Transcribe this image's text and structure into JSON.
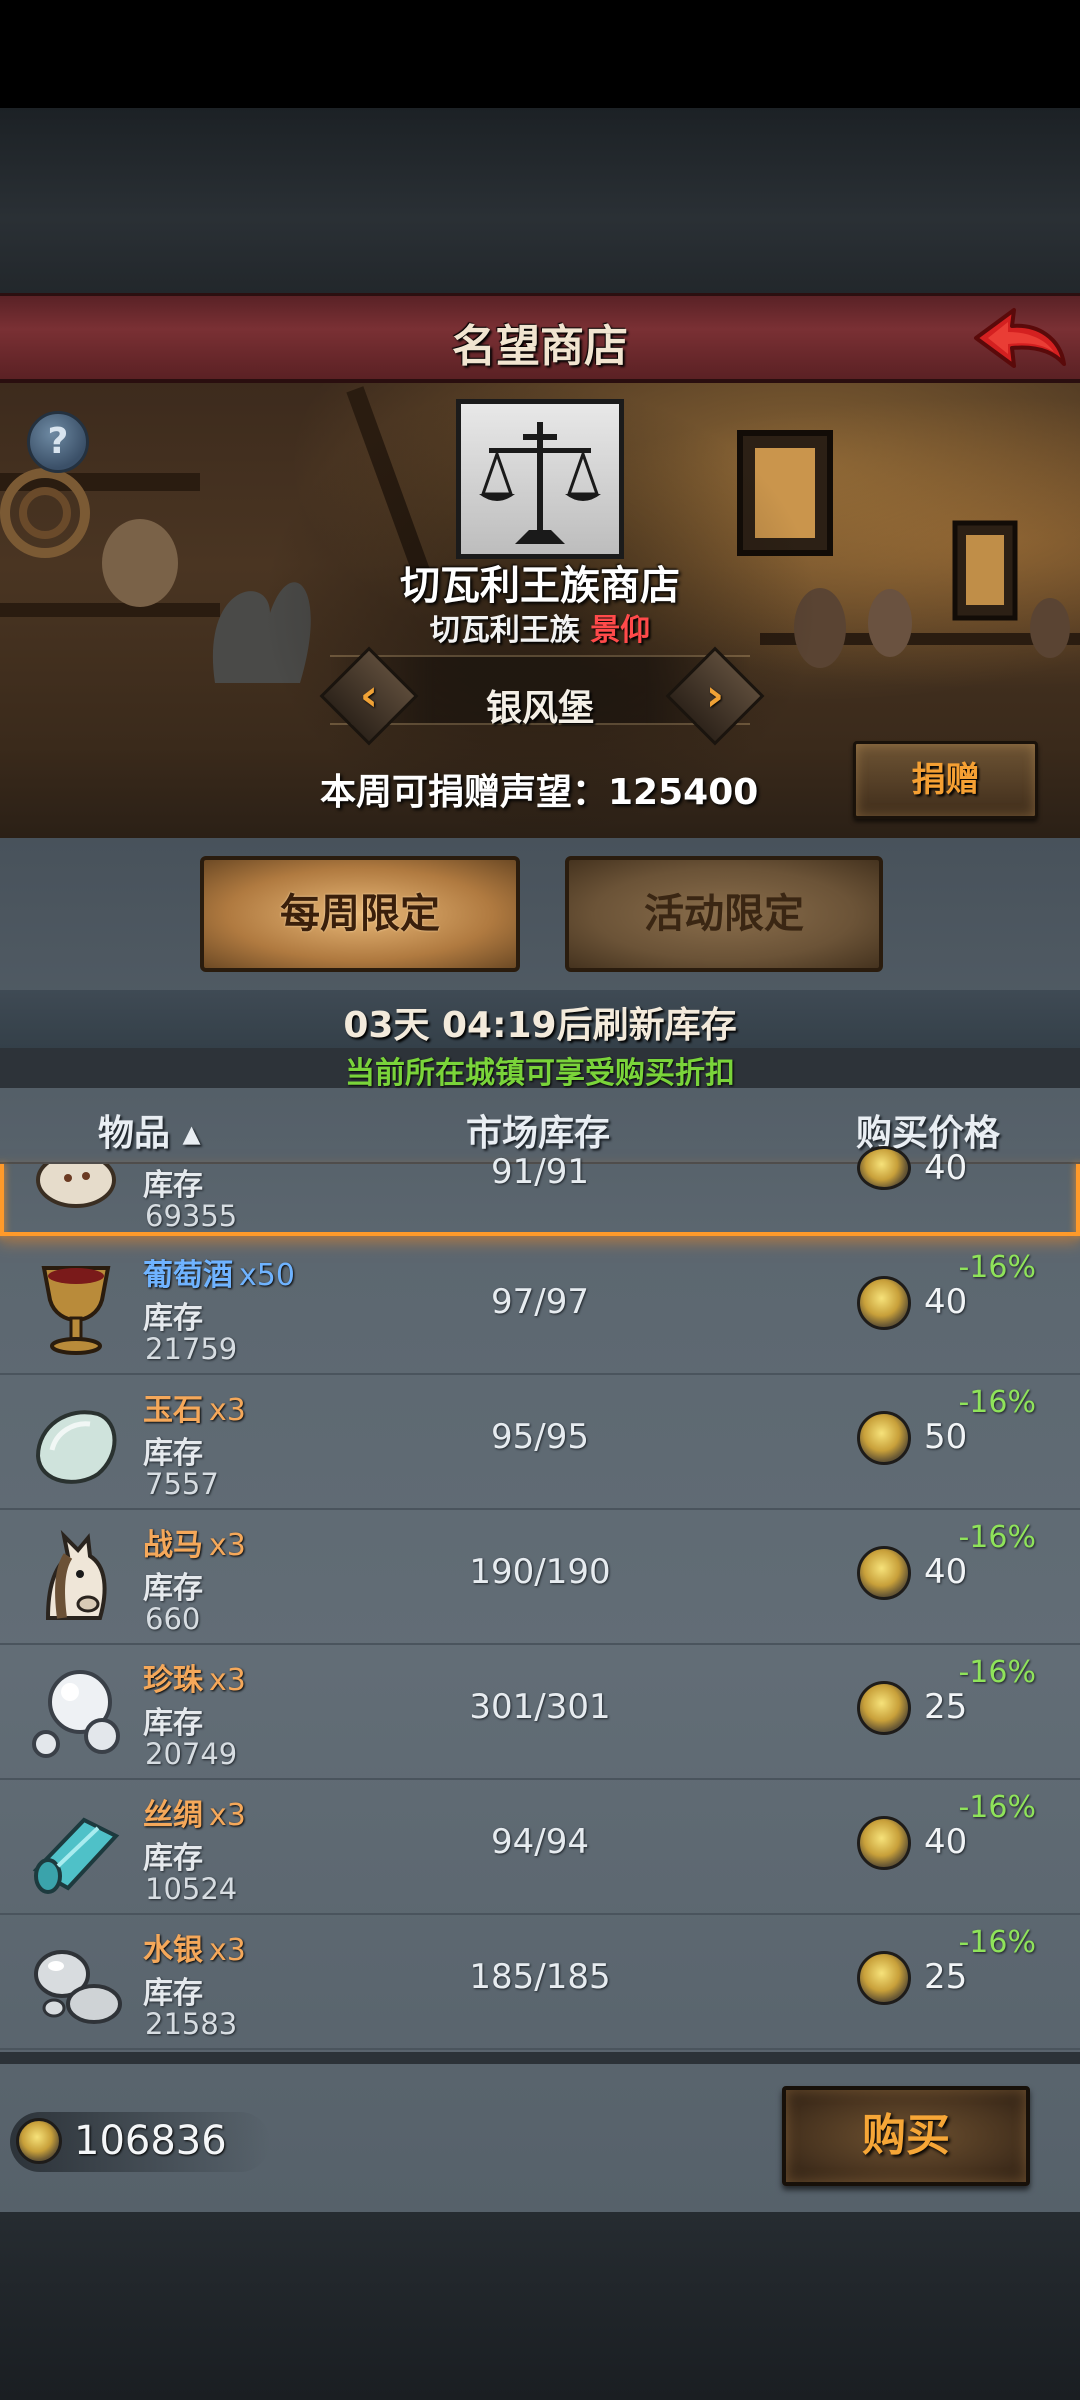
{
  "header": {
    "title": "名望商店"
  },
  "shop": {
    "name": "切瓦利王族商店",
    "faction": "切瓦利王族",
    "faction_status": "景仰",
    "city": "银风堡",
    "prev_arrow": "‹",
    "next_arrow": "›",
    "donate_text": "本周可捐赠声望：125400",
    "donate_button": "捐赠",
    "help": "?"
  },
  "tabs": [
    {
      "label": "每周限定",
      "active": true
    },
    {
      "label": "活动限定",
      "active": false
    }
  ],
  "refresh_text": "03天 04:19后刷新库存",
  "discount_notice": "当前所在城镇可享受购买折扣",
  "columns": {
    "item": "物品 ▴",
    "market_stock": "市场库存",
    "price": "购买价格"
  },
  "rows": [
    {
      "name": "",
      "qty": "",
      "stock_label": "库存",
      "stock": "69355",
      "market": "91/91",
      "price": "40",
      "discount": "",
      "icon": "bag-icon"
    },
    {
      "name": "葡萄酒",
      "qty": "x50",
      "stock_label": "库存",
      "stock": "21759",
      "market": "97/97",
      "price": "40",
      "discount": "-16%",
      "icon": "goblet-icon"
    },
    {
      "name": "玉石",
      "qty": "x3",
      "stock_label": "库存",
      "stock": "7557",
      "market": "95/95",
      "price": "50",
      "discount": "-16%",
      "icon": "jade-icon"
    },
    {
      "name": "战马",
      "qty": "x3",
      "stock_label": "库存",
      "stock": "660",
      "market": "190/190",
      "price": "40",
      "discount": "-16%",
      "icon": "horse-icon"
    },
    {
      "name": "珍珠",
      "qty": "x3",
      "stock_label": "库存",
      "stock": "20749",
      "market": "301/301",
      "price": "25",
      "discount": "-16%",
      "icon": "pearl-icon"
    },
    {
      "name": "丝绸",
      "qty": "x3",
      "stock_label": "库存",
      "stock": "10524",
      "market": "94/94",
      "price": "40",
      "discount": "-16%",
      "icon": "silk-icon"
    },
    {
      "name": "水银",
      "qty": "x3",
      "stock_label": "库存",
      "stock": "21583",
      "market": "185/185",
      "price": "25",
      "discount": "-16%",
      "icon": "mercury-icon"
    }
  ],
  "footer": {
    "currency": "106836",
    "buy_button": "购买"
  }
}
